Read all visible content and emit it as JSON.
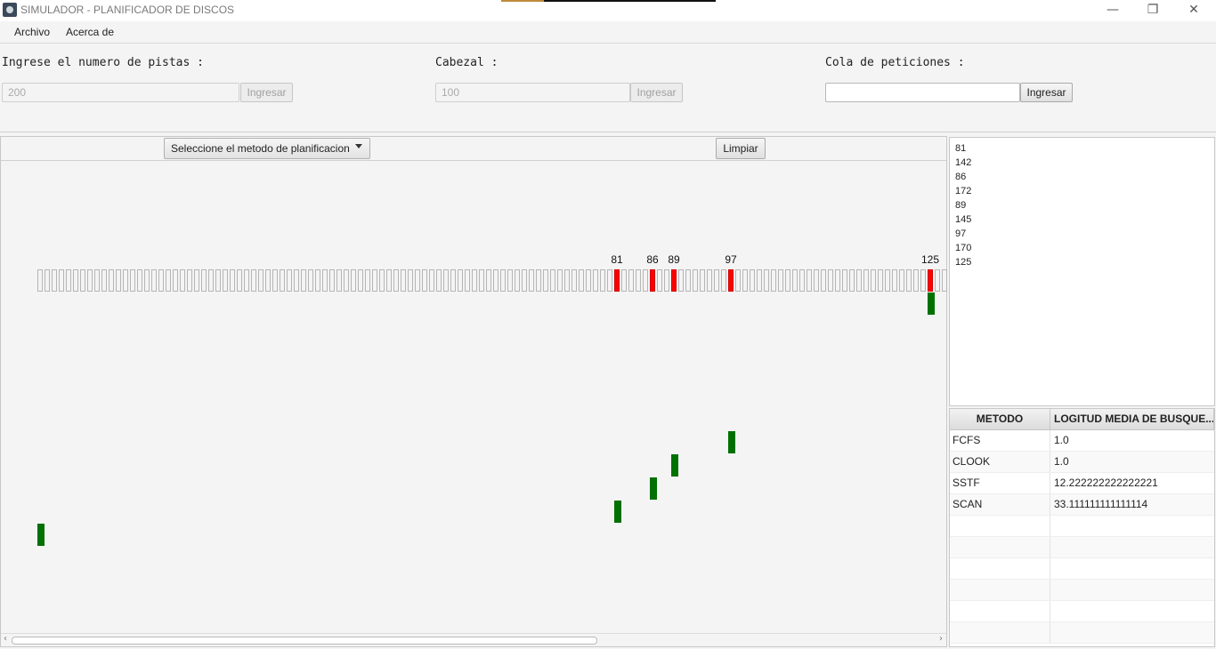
{
  "window": {
    "title": "SIMULADOR - PLANIFICADOR DE DISCOS",
    "minimize": "—",
    "restore": "❐",
    "close": "✕"
  },
  "menu": {
    "items": [
      "Archivo",
      "Acerca de"
    ]
  },
  "form": {
    "tracks": {
      "label": "Ingrese el numero de pistas :",
      "value": "200",
      "button": "Ingresar"
    },
    "head": {
      "label": "Cabezal :",
      "value": "100",
      "button": "Ingresar"
    },
    "queue": {
      "label": "Cola de peticiones :",
      "value": "",
      "button": "Ingresar"
    }
  },
  "toolbar": {
    "method_select": "Seleccione el metodo de planificacion",
    "clear_button": "Limpiar"
  },
  "track_labels": [
    "81",
    "86",
    "89",
    "97",
    "125"
  ],
  "queue_items": [
    "81",
    "142",
    "86",
    "172",
    "89",
    "145",
    "97",
    "170",
    "125"
  ],
  "results": {
    "headers": [
      "METODO",
      "LOGITUD MEDIA DE BUSQUE..."
    ],
    "rows": [
      [
        "FCFS",
        "1.0"
      ],
      [
        "CLOOK",
        "1.0"
      ],
      [
        "SSTF",
        "12.222222222222221"
      ],
      [
        "SCAN",
        "33.111111111111114"
      ]
    ]
  },
  "colors": {
    "requested_track": "#ff0000",
    "head_path": "#007000"
  }
}
